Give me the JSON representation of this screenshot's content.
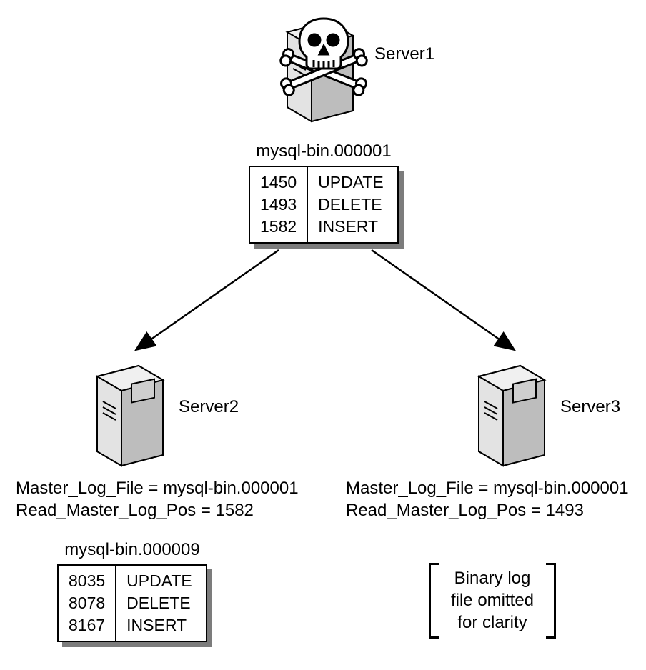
{
  "server1": {
    "label": "Server1"
  },
  "server2": {
    "label": "Server2",
    "status_line1": "Master_Log_File = mysql-bin.000001",
    "status_line2": "Read_Master_Log_Pos = 1582"
  },
  "server3": {
    "label": "Server3",
    "status_line1": "Master_Log_File = mysql-bin.000001",
    "status_line2": "Read_Master_Log_Pos = 1493"
  },
  "binlog1": {
    "title": "mysql-bin.000001",
    "rows": [
      {
        "pos": "1450",
        "op": "UPDATE"
      },
      {
        "pos": "1493",
        "op": "DELETE"
      },
      {
        "pos": "1582",
        "op": "INSERT"
      }
    ]
  },
  "binlog2": {
    "title": "mysql-bin.000009",
    "rows": [
      {
        "pos": "8035",
        "op": "UPDATE"
      },
      {
        "pos": "8078",
        "op": "DELETE"
      },
      {
        "pos": "8167",
        "op": "INSERT"
      }
    ]
  },
  "note": {
    "line1": "Binary log",
    "line2": "file omitted",
    "line3": "for clarity"
  }
}
